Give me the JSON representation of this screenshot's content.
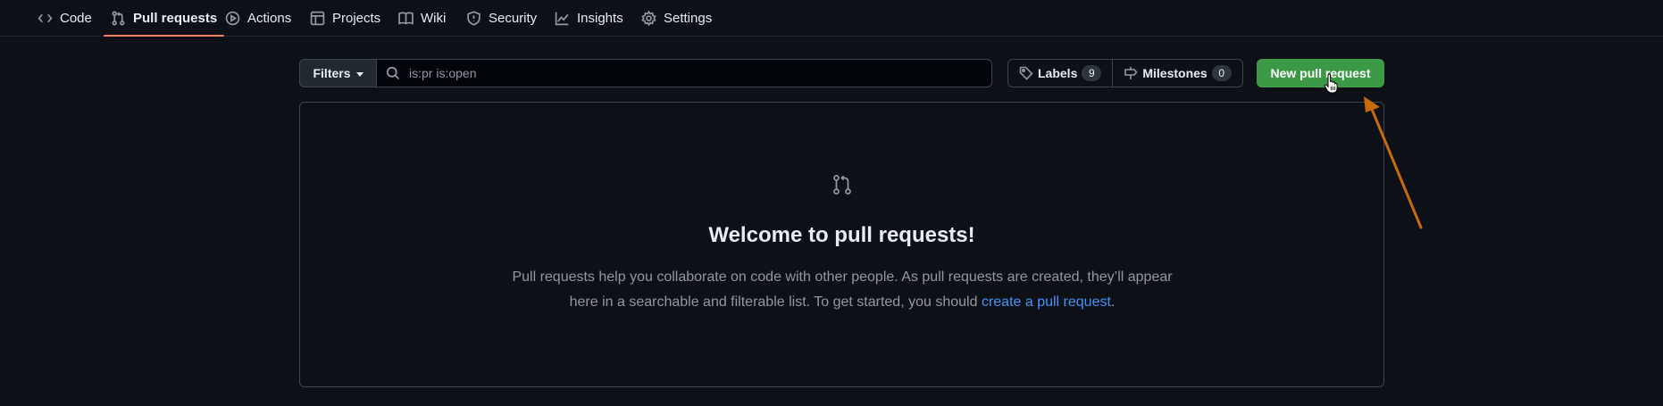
{
  "nav": {
    "tabs": [
      {
        "label": "Code",
        "icon": "code-icon"
      },
      {
        "label": "Pull requests",
        "icon": "git-pull-request-icon",
        "active": true
      },
      {
        "label": "Actions",
        "icon": "play-icon"
      },
      {
        "label": "Projects",
        "icon": "table-icon"
      },
      {
        "label": "Wiki",
        "icon": "book-icon"
      },
      {
        "label": "Security",
        "icon": "shield-icon"
      },
      {
        "label": "Insights",
        "icon": "graph-icon"
      },
      {
        "label": "Settings",
        "icon": "gear-icon"
      }
    ]
  },
  "toolbar": {
    "filters_label": "Filters",
    "search_value": "is:pr is:open",
    "labels_label": "Labels",
    "labels_count": "9",
    "milestones_label": "Milestones",
    "milestones_count": "0",
    "new_pr_label": "New pull request"
  },
  "empty_state": {
    "title": "Welcome to pull requests!",
    "text_before": "Pull requests help you collaborate on code with other people. As pull requests are created, they’ll appear here in a searchable and filterable list. To get started, you should ",
    "link_text": "create a pull request",
    "text_after": "."
  },
  "colors": {
    "background": "#0d1117",
    "active_underline": "#f78166",
    "primary_button": "#3c9a47",
    "link": "#4493f8",
    "annotation_arrow": "#c96a0a"
  }
}
